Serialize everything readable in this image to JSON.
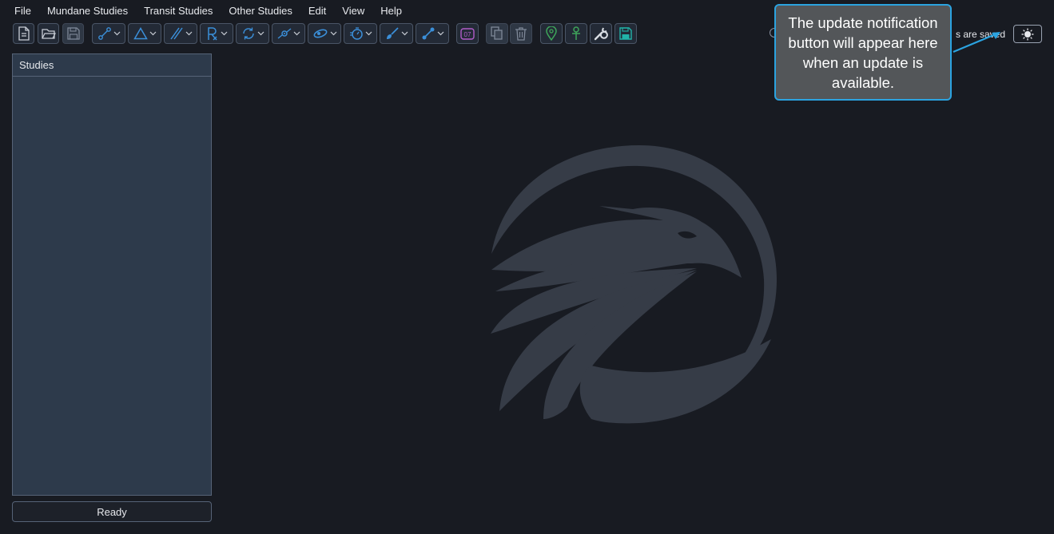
{
  "menu": [
    "File",
    "Mundane Studies",
    "Transit Studies",
    "Other Studies",
    "Edit",
    "View",
    "Help"
  ],
  "toolbar": {
    "buttons": [
      {
        "icon": "new-document-icon"
      },
      {
        "icon": "open-folder-icon"
      },
      {
        "icon": "save-disk-icon"
      },
      {
        "icon": "aspect-link-icon",
        "dropdown": true
      },
      {
        "icon": "triangle-icon",
        "dropdown": true
      },
      {
        "icon": "parallel-lines-icon",
        "dropdown": true
      },
      {
        "icon": "retrograde-rx-icon",
        "dropdown": true
      },
      {
        "icon": "cycle-refresh-icon",
        "dropdown": true
      },
      {
        "icon": "target-orbit-icon",
        "dropdown": true
      },
      {
        "icon": "ellipse-orbit-icon",
        "dropdown": true
      },
      {
        "icon": "timer-icon",
        "dropdown": true
      },
      {
        "icon": "paintbrush-icon",
        "dropdown": true
      },
      {
        "icon": "node-line-icon",
        "dropdown": true
      },
      {
        "icon": "calendar-icon",
        "text": "07"
      },
      {
        "icon": "copy-icon"
      },
      {
        "icon": "trash-icon"
      },
      {
        "icon": "location-pin-icon"
      },
      {
        "icon": "ankh-icon"
      },
      {
        "icon": "wrench-icon"
      },
      {
        "icon": "save-all-icon"
      }
    ]
  },
  "studies_panel": {
    "title": "Studies"
  },
  "status": {
    "ready_label": "Ready",
    "save_state": "s are saved"
  },
  "callout": {
    "text": "The update notification button will appear here when an update is available."
  },
  "colors": {
    "background": "#181b22",
    "panel": "#2d3a4b",
    "accent_blue": "#3b8fd9",
    "callout_border": "#2ba3e0",
    "logo": "#363c47"
  }
}
